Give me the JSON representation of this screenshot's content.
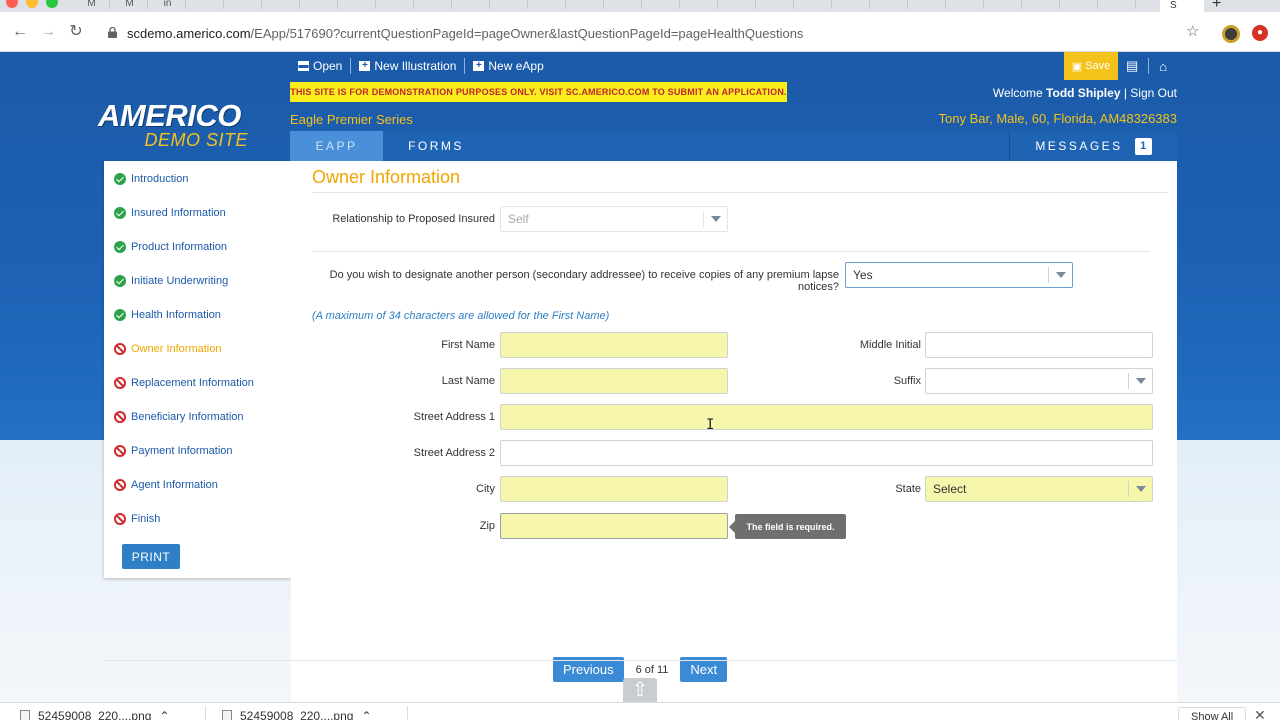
{
  "browser": {
    "tabs": [
      "M",
      "M",
      "in",
      "S"
    ],
    "active_tab": "S",
    "url_host": "scdemo.americo.com",
    "url_path": "/EApp/517690?currentQuestionPageId=pageOwner&lastQuestionPageId=pageHealthQuestions",
    "profile_badge": "●"
  },
  "logo": {
    "main": "AMERICO",
    "sub": "DEMO SITE"
  },
  "toolbar": {
    "open": "Open",
    "new_illustration": "New Illustration",
    "new_eapp": "New eApp",
    "save": "Save"
  },
  "header": {
    "demo_banner": "THIS SITE IS FOR DEMONSTRATION PURPOSES ONLY. VISIT SC.AMERICO.COM TO SUBMIT AN APPLICATION.",
    "welcome_prefix": "Welcome",
    "user_name": "Todd Shipley",
    "sign_out": "Sign Out",
    "series": "Eagle Premier Series",
    "client_info": "Tony Bar, Male, 60, Florida, AM48326383"
  },
  "tabs": {
    "eapp": "EAPP",
    "forms": "FORMS",
    "messages": "MESSAGES",
    "messages_count": "1"
  },
  "sidebar": {
    "items": [
      {
        "label": "Introduction",
        "status": "complete"
      },
      {
        "label": "Insured Information",
        "status": "complete"
      },
      {
        "label": "Product Information",
        "status": "complete"
      },
      {
        "label": "Initiate Underwriting",
        "status": "complete"
      },
      {
        "label": "Health Information",
        "status": "complete"
      },
      {
        "label": "Owner Information",
        "status": "current"
      },
      {
        "label": "Replacement Information",
        "status": "incomplete"
      },
      {
        "label": "Beneficiary Information",
        "status": "incomplete"
      },
      {
        "label": "Payment Information",
        "status": "incomplete"
      },
      {
        "label": "Agent Information",
        "status": "incomplete"
      },
      {
        "label": "Finish",
        "status": "incomplete"
      }
    ],
    "print": "PRINT"
  },
  "form": {
    "title": "Owner Information",
    "relationship_label": "Relationship to Proposed Insured",
    "relationship_value": "Self",
    "secondary_label_1": "Do you wish to designate another person (secondary addressee) to receive copies of any premium lapse",
    "secondary_label_2": "notices?",
    "secondary_value": "Yes",
    "note": "(A maximum of 34 characters are allowed for the First Name)",
    "first_name_label": "First Name",
    "first_name_value": "",
    "middle_initial_label": "Middle Initial",
    "middle_initial_value": "",
    "last_name_label": "Last Name",
    "last_name_value": "",
    "suffix_label": "Suffix",
    "suffix_value": "",
    "street1_label": "Street Address 1",
    "street1_value": "",
    "street2_label": "Street Address 2",
    "street2_value": "",
    "city_label": "City",
    "city_value": "",
    "state_label": "State",
    "state_value": "Select",
    "zip_label": "Zip",
    "zip_value": "",
    "zip_error": "The field is required."
  },
  "pager": {
    "previous": "Previous",
    "position": "6 of 11",
    "next": "Next"
  },
  "downloads": {
    "items": [
      "52459008_220....png",
      "52459008_220....png"
    ],
    "show_all": "Show All"
  },
  "colors": {
    "brand_blue": "#1b5aa8",
    "accent_gold": "#f4c21b",
    "required_yellow": "#f6f7ad",
    "complete_green": "#2ca24b",
    "incomplete_red": "#d02a2a"
  }
}
